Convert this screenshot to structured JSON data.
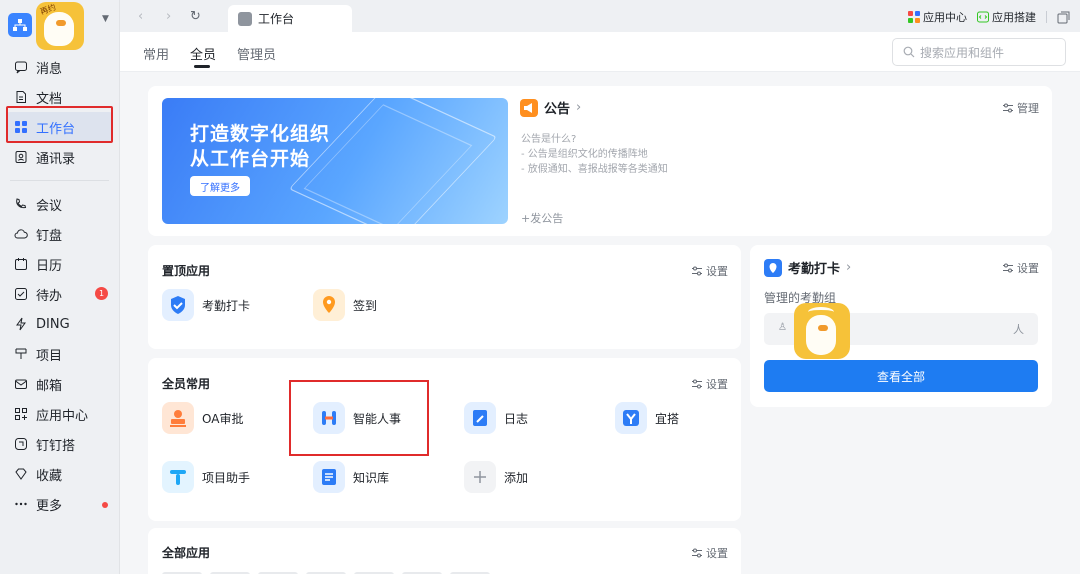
{
  "sidebar": {
    "avatar_text": "再约",
    "items": [
      {
        "label": "消息",
        "icon": "message-icon"
      },
      {
        "label": "文档",
        "icon": "doc-icon"
      },
      {
        "label": "工作台",
        "icon": "workbench-icon",
        "active": true
      },
      {
        "label": "通讯录",
        "icon": "contacts-icon"
      },
      {
        "label": "会议",
        "icon": "meeting-icon"
      },
      {
        "label": "钉盘",
        "icon": "cloud-disk-icon"
      },
      {
        "label": "日历",
        "icon": "calendar-icon"
      },
      {
        "label": "待办",
        "icon": "todo-icon",
        "badge": "1"
      },
      {
        "label": "DING",
        "icon": "ding-icon"
      },
      {
        "label": "项目",
        "icon": "project-icon"
      },
      {
        "label": "邮箱",
        "icon": "mail-icon"
      },
      {
        "label": "应用中心",
        "icon": "app-center-icon"
      },
      {
        "label": "钉钉搭",
        "icon": "dingda-icon"
      },
      {
        "label": "收藏",
        "icon": "favorite-icon"
      },
      {
        "label": "更多",
        "icon": "more-icon",
        "dot": true
      }
    ]
  },
  "topbar": {
    "tab_label": "工作台",
    "app_center": "应用中心",
    "app_builder": "应用搭建"
  },
  "subnav": {
    "tabs": [
      "常用",
      "全员",
      "管理员"
    ],
    "active_tab": "全员",
    "search_placeholder": "搜索应用和组件"
  },
  "banner": {
    "line1": "打造数字化组织",
    "line2": "从工作台开始",
    "button": "了解更多"
  },
  "announcement": {
    "title": "公告",
    "manage": "管理",
    "lines": [
      "公告是什么?",
      "- 公告是组织文化的传播阵地",
      "- 放假通知、喜报战报等各类通知"
    ],
    "add": "发公告"
  },
  "pinned": {
    "title": "置顶应用",
    "settings": "设置",
    "apps": [
      {
        "label": "考勤打卡",
        "icon": "attendance-icon"
      },
      {
        "label": "签到",
        "icon": "checkin-icon"
      }
    ]
  },
  "common": {
    "title": "全员常用",
    "settings": "设置",
    "apps": [
      {
        "label": "OA审批",
        "icon": "oa-approval-icon"
      },
      {
        "label": "智能人事",
        "icon": "smart-hr-icon"
      },
      {
        "label": "日志",
        "icon": "log-icon"
      },
      {
        "label": "宜搭",
        "icon": "yida-icon"
      },
      {
        "label": "项目助手",
        "icon": "project-assistant-icon"
      },
      {
        "label": "知识库",
        "icon": "knowledge-base-icon"
      },
      {
        "label": "添加",
        "icon": "add-icon"
      }
    ]
  },
  "all_apps": {
    "title": "全部应用",
    "settings": "设置"
  },
  "attendance": {
    "title": "考勤打卡",
    "settings": "设置",
    "group_label": "管理的考勤组",
    "people_suffix": "人",
    "cta": "查看全部"
  },
  "colors": {
    "accent": "#3370ff",
    "highlight": "#e02b2b",
    "cta": "#1e7cf2"
  }
}
